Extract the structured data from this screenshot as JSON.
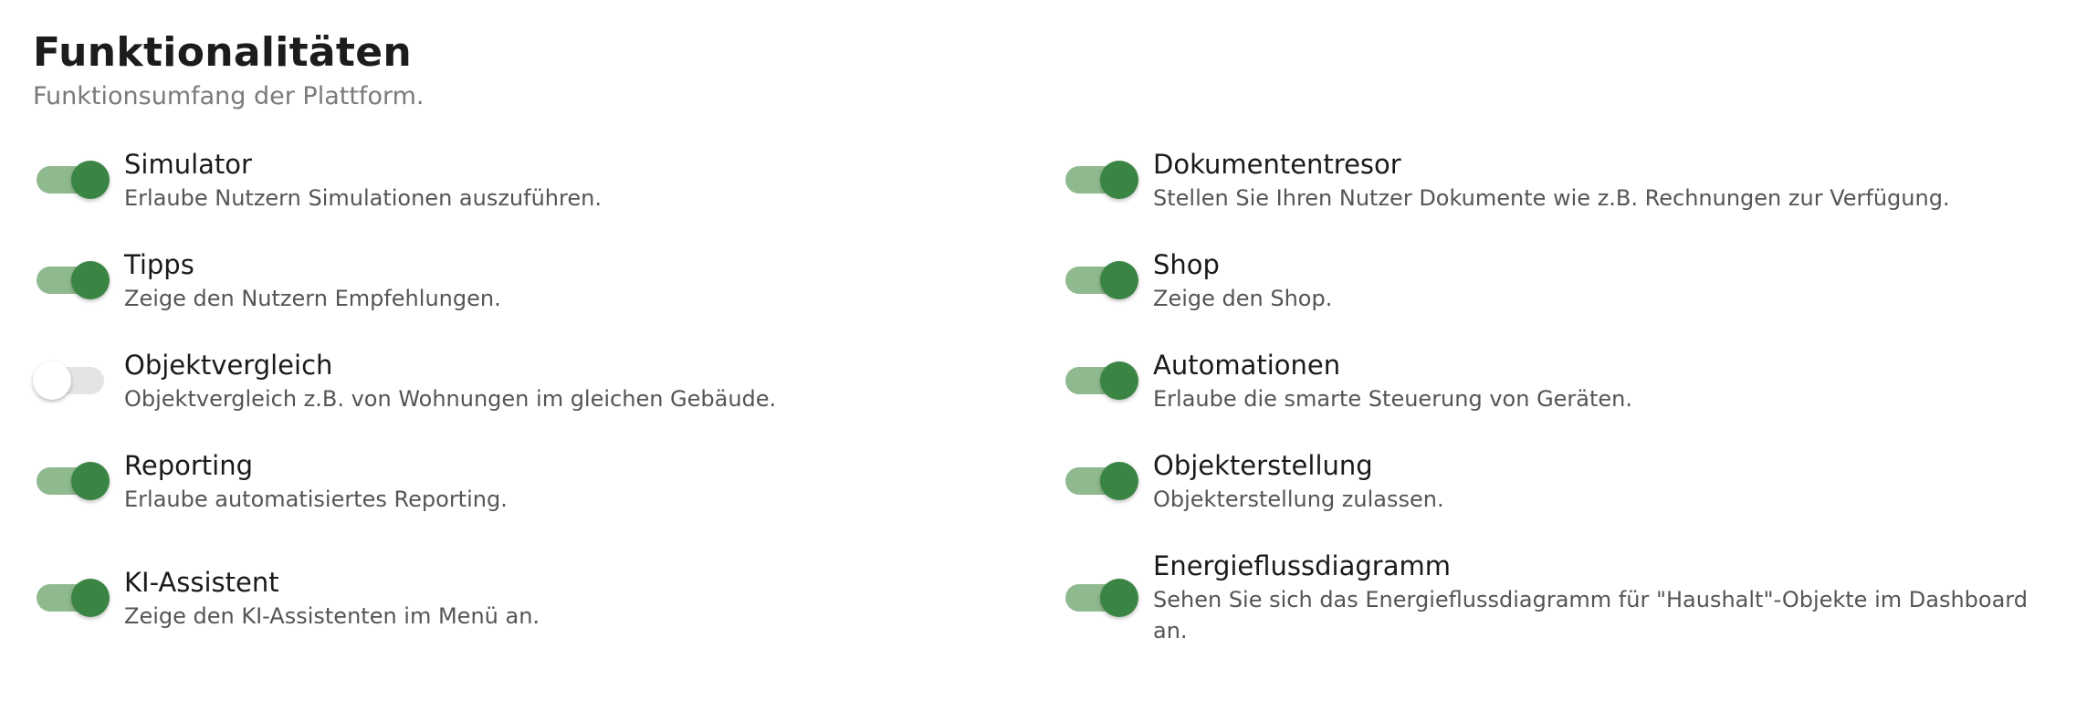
{
  "header": {
    "title": "Funktionalitäten",
    "subtitle": "Funktionsumfang der Plattform."
  },
  "colors": {
    "toggle_on_thumb": "#3a8543",
    "toggle_on_track": "#8fb98f",
    "toggle_off_track": "#e4e4e4",
    "toggle_off_thumb": "#ffffff"
  },
  "features": {
    "left": [
      {
        "name": "Simulator",
        "description": "Erlaube Nutzern Simulationen auszuführen.",
        "enabled": true
      },
      {
        "name": "Tipps",
        "description": "Zeige den Nutzern Empfehlungen.",
        "enabled": true
      },
      {
        "name": "Objektvergleich",
        "description": "Objektvergleich z.B. von Wohnungen im gleichen Gebäude.",
        "enabled": false
      },
      {
        "name": "Reporting",
        "description": "Erlaube automatisiertes Reporting.",
        "enabled": true
      },
      {
        "name": "KI-Assistent",
        "description": "Zeige den KI-Assistenten im Menü an.",
        "enabled": true
      }
    ],
    "right": [
      {
        "name": "Dokumententresor",
        "description": "Stellen Sie Ihren Nutzer Dokumente wie z.B. Rechnungen zur Verfügung.",
        "enabled": true
      },
      {
        "name": "Shop",
        "description": "Zeige den Shop.",
        "enabled": true
      },
      {
        "name": "Automationen",
        "description": "Erlaube die smarte Steuerung von Geräten.",
        "enabled": true
      },
      {
        "name": "Objekterstellung",
        "description": "Objekterstellung zulassen.",
        "enabled": true
      },
      {
        "name": "Energieflussdiagramm",
        "description": "Sehen Sie sich das Energieflussdiagramm für \"Haushalt\"-Objekte im Dashboard an.",
        "enabled": true
      }
    ]
  }
}
